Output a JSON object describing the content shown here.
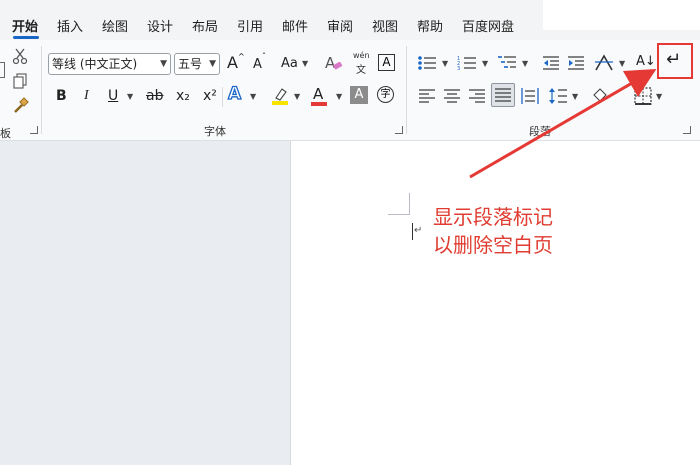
{
  "menubar": {
    "tabs": [
      "开始",
      "插入",
      "绘图",
      "设计",
      "布局",
      "引用",
      "邮件",
      "审阅",
      "视图",
      "帮助",
      "百度网盘"
    ],
    "active_tab": "开始"
  },
  "ribbon": {
    "font_group": {
      "label": "字体",
      "font_name": "等线 (中文正文)",
      "font_size": "五号",
      "grow_label": "A",
      "shrink_label": "A",
      "change_case_label": "Aa",
      "phonetic_top": "wén",
      "phonetic_bottom": "文",
      "char_border_label": "A",
      "bold_label": "B",
      "italic_label": "I",
      "underline_label": "U",
      "strike_label": "ab",
      "subscript_label": "x₂",
      "superscript_label": "x²",
      "text_effect_label": "A",
      "font_color_label": "A",
      "char_shading_label": "A",
      "enclose_label": "字"
    },
    "paragraph_group": {
      "label": "段落",
      "sort_label": "A↓",
      "show_marks_label": "↵"
    },
    "clipboard_group": {
      "label": "板"
    }
  },
  "colors": {
    "accent": "#1a66c8",
    "annotation": "#e03c31",
    "highlight_yellow": "#f5e400",
    "font_red": "#e53935"
  },
  "document": {
    "paragraph_mark": "↵"
  },
  "annotation": {
    "line1": "显示段落标记",
    "line2": "以删除空白页"
  }
}
